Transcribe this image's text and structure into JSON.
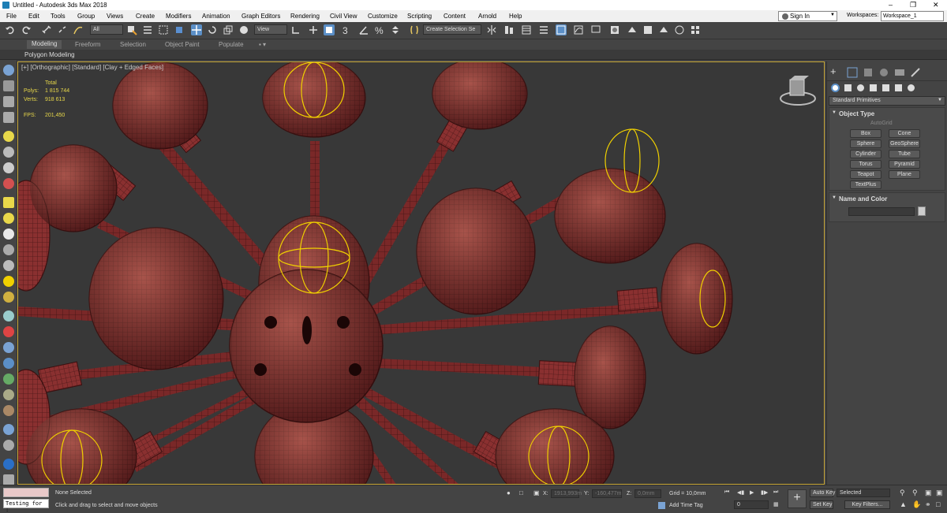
{
  "window": {
    "title": "Untitled - Autodesk 3ds Max 2018"
  },
  "menu": {
    "items": [
      "File",
      "Edit",
      "Tools",
      "Group",
      "Views",
      "Create",
      "Modifiers",
      "Animation",
      "Graph Editors",
      "Rendering",
      "Civil View",
      "Customize",
      "Scripting",
      "Content",
      "Arnold",
      "Help"
    ],
    "sign_in": "Sign In",
    "workspaces_label": "Workspaces:",
    "workspace_value": "Workspace_1"
  },
  "toolbar": {
    "selection_filter": "All",
    "ref_coord": "View",
    "named_selection": "Create Selection Se"
  },
  "ribbon": {
    "tabs": [
      "Modeling",
      "Freeform",
      "Selection",
      "Object Paint",
      "Populate"
    ],
    "sub_label": "Polygon Modeling"
  },
  "viewport": {
    "label": "[+] [Orthographic] [Standard] [Clay + Edged Faces]",
    "stats": {
      "total_label": "Total",
      "polys_label": "Polys:",
      "polys_value": "1 815 744",
      "verts_label": "Verts:",
      "verts_value": "918 613",
      "fps_label": "FPS:",
      "fps_value": "201,450"
    }
  },
  "command_panel": {
    "category": "Standard Primitives",
    "object_type_title": "Object Type",
    "autogrid": "AutoGrid",
    "buttons": [
      "Box",
      "Cone",
      "Sphere",
      "GeoSphere",
      "Cylinder",
      "Tube",
      "Torus",
      "Pyramid",
      "Teapot",
      "Plane",
      "TextPlus"
    ],
    "name_color_title": "Name and Color"
  },
  "status": {
    "listener": "Testing for :",
    "selection": "None Selected",
    "prompt": "Click and drag to select and move objects",
    "x_label": "X:",
    "x_value": "1913,993m",
    "y_label": "Y:",
    "y_value": "-160,477m",
    "z_label": "Z:",
    "z_value": "0,0mm",
    "grid": "Grid = 10,0mm",
    "add_time_tag": "Add Time Tag",
    "frame": "0",
    "auto_key": "Auto Key",
    "set_key": "Set Key",
    "selected": "Selected",
    "key_filters": "Key Filters..."
  },
  "colors": {
    "model": "#8a3030",
    "selection": "#f0d000",
    "viewport_bg": "#383838",
    "border": "#c8a838"
  }
}
